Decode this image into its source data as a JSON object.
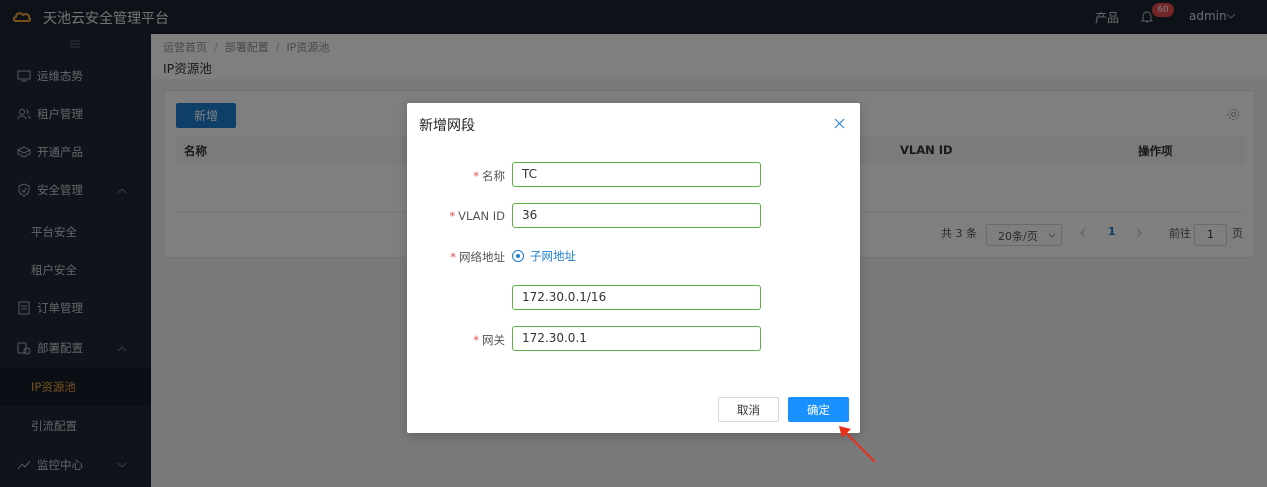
{
  "app": {
    "title": "天池云安全管理平台"
  },
  "topbar": {
    "product": "产品",
    "notification_count": "60",
    "user": "admin"
  },
  "sidebar": {
    "items": [
      {
        "label": "运维态势",
        "icon": "monitor-icon"
      },
      {
        "label": "租户管理",
        "icon": "users-icon"
      },
      {
        "label": "开通产品",
        "icon": "box-icon"
      },
      {
        "label": "安全管理",
        "icon": "shield-icon"
      },
      {
        "label": "平台安全"
      },
      {
        "label": "租户安全"
      },
      {
        "label": "订单管理",
        "icon": "order-icon"
      },
      {
        "label": "部署配置",
        "icon": "deploy-icon"
      },
      {
        "label": "IP资源池"
      },
      {
        "label": "引流配置"
      },
      {
        "label": "监控中心",
        "icon": "monitor-center-icon"
      }
    ],
    "active_color": "#f0a33a"
  },
  "breadcrumb": [
    "运营首页",
    "部署配置",
    "IP资源池"
  ],
  "page": {
    "title": "IP资源池"
  },
  "toolbar": {
    "add_label": "新增"
  },
  "table": {
    "columns": [
      "名称",
      "VLAN ID",
      "操作项"
    ]
  },
  "pagination": {
    "total": "共 3 条",
    "page_size": "20条/页",
    "current": "1",
    "goto_prefix": "前往",
    "goto_value": "1",
    "goto_suffix": "页"
  },
  "modal": {
    "title": "新增网段",
    "fields": {
      "name": {
        "label": "名称",
        "value": "TC"
      },
      "vlan": {
        "label": "VLAN ID",
        "value": "36"
      },
      "network": {
        "label": "网络地址",
        "option": "子网地址",
        "value": "172.30.0.1/16"
      },
      "gateway": {
        "label": "网关",
        "value": "172.30.0.1"
      }
    },
    "cancel_label": "取消",
    "ok_label": "确定",
    "required_mark": "*"
  },
  "colors": {
    "primary": "#1890ff",
    "input_border": "#59b344",
    "annotation_arrow": "#e8311a"
  }
}
